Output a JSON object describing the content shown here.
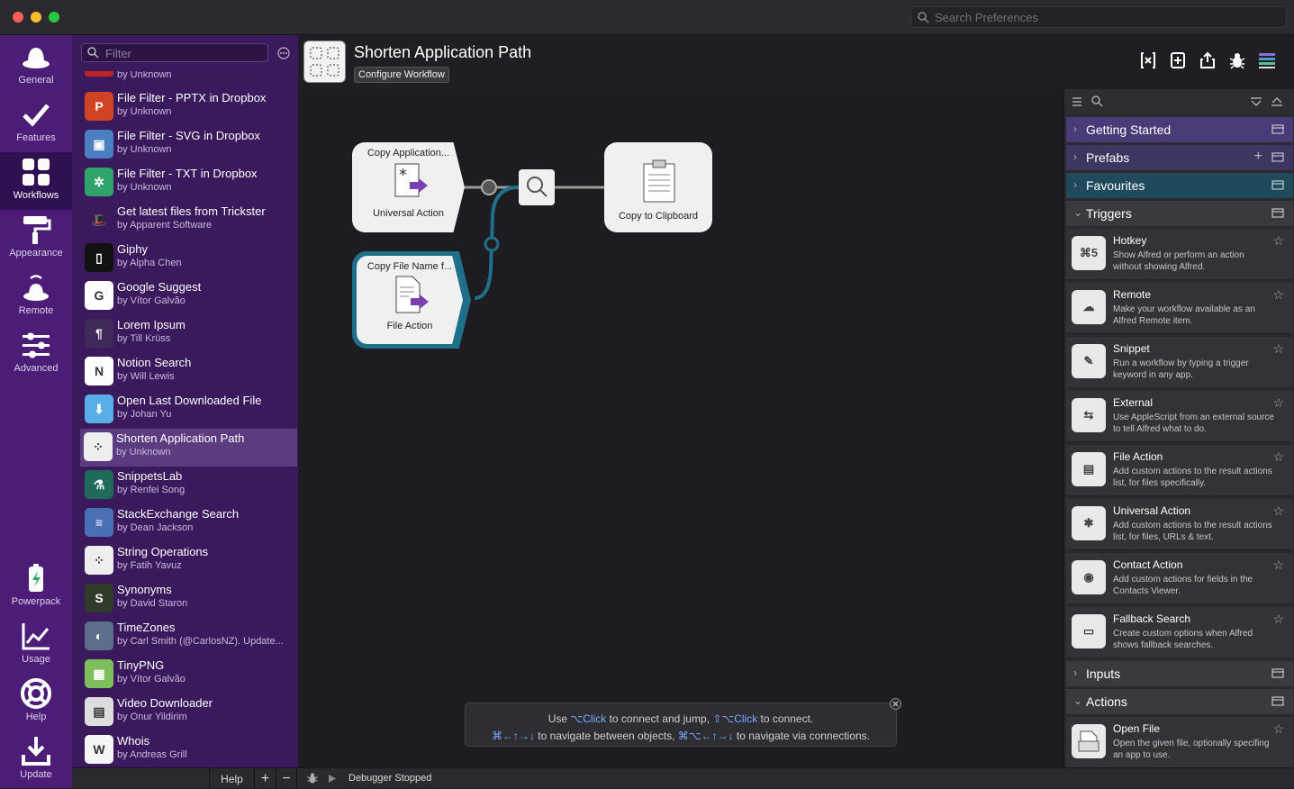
{
  "titlebar": {
    "search_placeholder": "Search Preferences"
  },
  "nav": [
    {
      "label": "General"
    },
    {
      "label": "Features"
    },
    {
      "label": "Workflows"
    },
    {
      "label": "Appearance"
    },
    {
      "label": "Remote"
    },
    {
      "label": "Advanced"
    },
    {
      "label": "Powerpack"
    },
    {
      "label": "Usage"
    },
    {
      "label": "Help"
    },
    {
      "label": "Update"
    }
  ],
  "list": {
    "filter_placeholder": "Filter",
    "partial_author": "by Unknown",
    "items": [
      {
        "title": "File Filter - PPTX in Dropbox",
        "author": "by Unknown",
        "icon_color": "#d04423",
        "icon_text": "P"
      },
      {
        "title": "File Filter - SVG in Dropbox",
        "author": "by Unknown",
        "icon_color": "#4a7fc1",
        "icon_text": "▣"
      },
      {
        "title": "File Filter - TXT in Dropbox",
        "author": "by Unknown",
        "icon_color": "#2fa36b",
        "icon_text": "✲"
      },
      {
        "title": "Get latest files from Trickster",
        "author": "by Apparent Software",
        "icon_color": "#3a1a5c",
        "icon_text": "🎩"
      },
      {
        "title": "Giphy",
        "author": "by Alpha Chen",
        "icon_color": "#111111",
        "icon_text": "▯"
      },
      {
        "title": "Google Suggest",
        "author": "by Vítor Galvão",
        "icon_color": "#ffffff",
        "icon_text": "G"
      },
      {
        "title": "Lorem Ipsum",
        "author": "by Till Krüss",
        "icon_color": "#3f2a5a",
        "icon_text": "¶"
      },
      {
        "title": "Notion Search",
        "author": "by Will Lewis",
        "icon_color": "#ffffff",
        "icon_text": "N"
      },
      {
        "title": "Open Last Downloaded File",
        "author": "by Johan Yu",
        "icon_color": "#5aaee8",
        "icon_text": "⬇"
      },
      {
        "title": "Shorten Application Path",
        "author": "by Unknown",
        "icon_color": "#eeeeee",
        "icon_text": "⁘"
      },
      {
        "title": "SnippetsLab",
        "author": "by Renfei Song",
        "icon_color": "#1e6b5a",
        "icon_text": "⚗"
      },
      {
        "title": "StackExchange Search",
        "author": "by Dean Jackson",
        "icon_color": "#4a6fb5",
        "icon_text": "≡"
      },
      {
        "title": "String Operations",
        "author": "by Fatih Yavuz",
        "icon_color": "#eeeeee",
        "icon_text": "⁘"
      },
      {
        "title": "Synonyms",
        "author": "by David Staron",
        "icon_color": "#2f3a2a",
        "icon_text": "S"
      },
      {
        "title": "TimeZones",
        "author": "by Carl Smith (@CarlosNZ). Update...",
        "icon_color": "#5b6f8a",
        "icon_text": "◐"
      },
      {
        "title": "TinyPNG",
        "author": "by Vítor Galvão",
        "icon_color": "#7dbf5a",
        "icon_text": "▦"
      },
      {
        "title": "Video Downloader",
        "author": "by Onur Yildirim",
        "icon_color": "#dddddd",
        "icon_text": "▤"
      },
      {
        "title": "Whois",
        "author": "by Andreas Grill",
        "icon_color": "#f5f5f5",
        "icon_text": "W"
      }
    ]
  },
  "header": {
    "title": "Shorten Application Path",
    "configure": "Configure Workflow"
  },
  "canvas": {
    "node1_title": "Copy Application...",
    "node1_sub": "Universal Action",
    "node2_title": "Copy File Name f...",
    "node2_sub": "File Action",
    "node3_sub": "Copy to Clipboard",
    "hint_line1_a": "Use ",
    "hint_line1_b": "⌥Click",
    "hint_line1_c": " to connect and jump, ",
    "hint_line1_d": "⇧⌥Click",
    "hint_line1_e": " to connect.",
    "hint_line2_a": "⌘←↑→↓",
    "hint_line2_b": " to navigate between objects, ",
    "hint_line2_c": "⌘⌥←↑→↓",
    "hint_line2_d": " to navigate via connections."
  },
  "right": {
    "sections": [
      "Getting Started",
      "Prefabs",
      "Favourites",
      "Triggers",
      "Inputs",
      "Actions"
    ],
    "triggers": [
      {
        "title": "Hotkey",
        "desc": "Show Alfred or perform an action without showing Alfred."
      },
      {
        "title": "Remote",
        "desc": "Make your workflow available as an Alfred Remote item."
      },
      {
        "title": "Snippet",
        "desc": "Run a workflow by typing a trigger keyword in any app."
      },
      {
        "title": "External",
        "desc": "Use AppleScript from an external source to tell Alfred what to do."
      },
      {
        "title": "File Action",
        "desc": "Add custom actions to the result actions list, for files specifically."
      },
      {
        "title": "Universal Action",
        "desc": "Add custom actions to the result actions list, for files, URLs & text."
      },
      {
        "title": "Contact Action",
        "desc": "Add custom actions for fields in the Contacts Viewer."
      },
      {
        "title": "Fallback Search",
        "desc": "Create custom options when Alfred shows fallback searches."
      }
    ],
    "actions": [
      {
        "title": "Open File",
        "desc": "Open the given file, optionally specifing an app to use."
      }
    ]
  },
  "bottom": {
    "help": "Help",
    "plus": "+",
    "minus": "−",
    "debugger": "Debugger Stopped"
  },
  "colors": {
    "accent_purple": "#4b1d77",
    "connection": "#1f6f8b"
  }
}
